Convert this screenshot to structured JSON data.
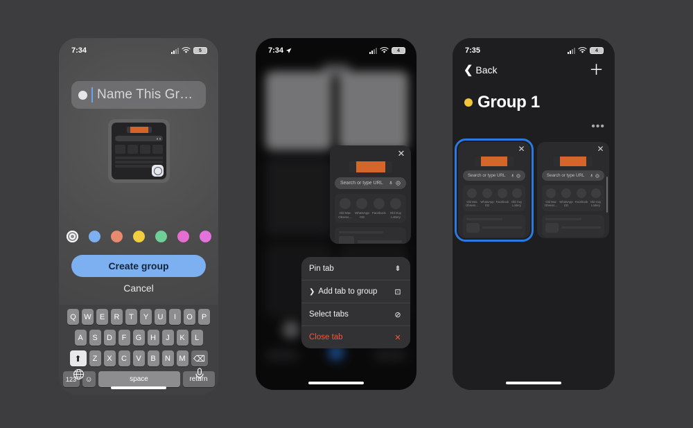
{
  "page": {
    "background": "#3d3d40"
  },
  "phone1": {
    "status": {
      "time": "7:34",
      "battery": "5",
      "wifi_icon": "wifi-icon",
      "signal_icon": "cellular-icon"
    },
    "name_field": {
      "placeholder": "Name This Gr…",
      "dot_color": "#e6e6e6"
    },
    "swatches": [
      {
        "name": "gray-selected",
        "color": "#8e8e93",
        "selected": true
      },
      {
        "name": "blue",
        "color": "#7cb0f0",
        "selected": false
      },
      {
        "name": "salmon",
        "color": "#e78a6e",
        "selected": false
      },
      {
        "name": "yellow",
        "color": "#f2ce3e",
        "selected": false
      },
      {
        "name": "green",
        "color": "#6fcf97",
        "selected": false
      },
      {
        "name": "magenta",
        "color": "#e56fd0",
        "selected": false
      },
      {
        "name": "pink",
        "color": "#e472dd",
        "selected": false
      }
    ],
    "create_label": "Create group",
    "cancel_label": "Cancel",
    "keyboard": {
      "row1": [
        "Q",
        "W",
        "E",
        "R",
        "T",
        "Y",
        "U",
        "I",
        "O",
        "P"
      ],
      "row2": [
        "A",
        "S",
        "D",
        "F",
        "G",
        "H",
        "J",
        "K",
        "L"
      ],
      "row3": [
        "Z",
        "X",
        "C",
        "V",
        "B",
        "N",
        "M"
      ],
      "shift": "⬆",
      "delete": "⌫",
      "numbers": "123",
      "emoji": "☺",
      "space": "space",
      "return": "return",
      "globe": "🌐",
      "mic": "🎙"
    }
  },
  "phone2": {
    "status": {
      "time": "7:34",
      "battery": "4",
      "location_icon": "location-arrow-icon"
    },
    "tab_preview": {
      "url_placeholder": "Search or type URL",
      "mic_icon": "microphone-icon",
      "translate_icon": "translate-icon",
      "close_icon": "close-icon",
      "favorites": [
        "Old Mac Obsess…",
        "WhatsApp GD",
        "Facebook",
        "Old Guy Lottery"
      ]
    },
    "context_menu": [
      {
        "label": "Pin tab",
        "icon": "pin-icon",
        "glyph": "⇥",
        "submenu": false,
        "danger": false
      },
      {
        "label": "Add tab to group",
        "icon": "add-to-group-icon",
        "glyph": "⊡",
        "submenu": true,
        "danger": false
      },
      {
        "label": "Select tabs",
        "icon": "check-circle-icon",
        "glyph": "⊘",
        "submenu": false,
        "danger": false
      },
      {
        "label": "Close tab",
        "icon": "close-x-icon",
        "glyph": "✕",
        "submenu": false,
        "danger": true
      }
    ]
  },
  "phone3": {
    "status": {
      "time": "7:35",
      "battery": "4"
    },
    "nav": {
      "back_label": "Back",
      "back_icon": "chevron-left-icon",
      "add_icon": "plus-icon"
    },
    "title": {
      "text": "Group 1",
      "dot_color": "#f2c53d"
    },
    "more_icon": "ellipsis-icon",
    "tabs": [
      {
        "active": true,
        "url_placeholder": "Search or type URL",
        "close_icon": "close-icon",
        "favorites": [
          "Old Mac Obsess…",
          "WhatsApp GD",
          "Facebook",
          "Old Guy Lottery"
        ]
      },
      {
        "active": false,
        "url_placeholder": "Search or type URL",
        "close_icon": "close-icon",
        "favorites": [
          "Old Mac Obsess…",
          "WhatsApp GD",
          "Facebook",
          "Old Guy Lottery"
        ]
      }
    ]
  }
}
